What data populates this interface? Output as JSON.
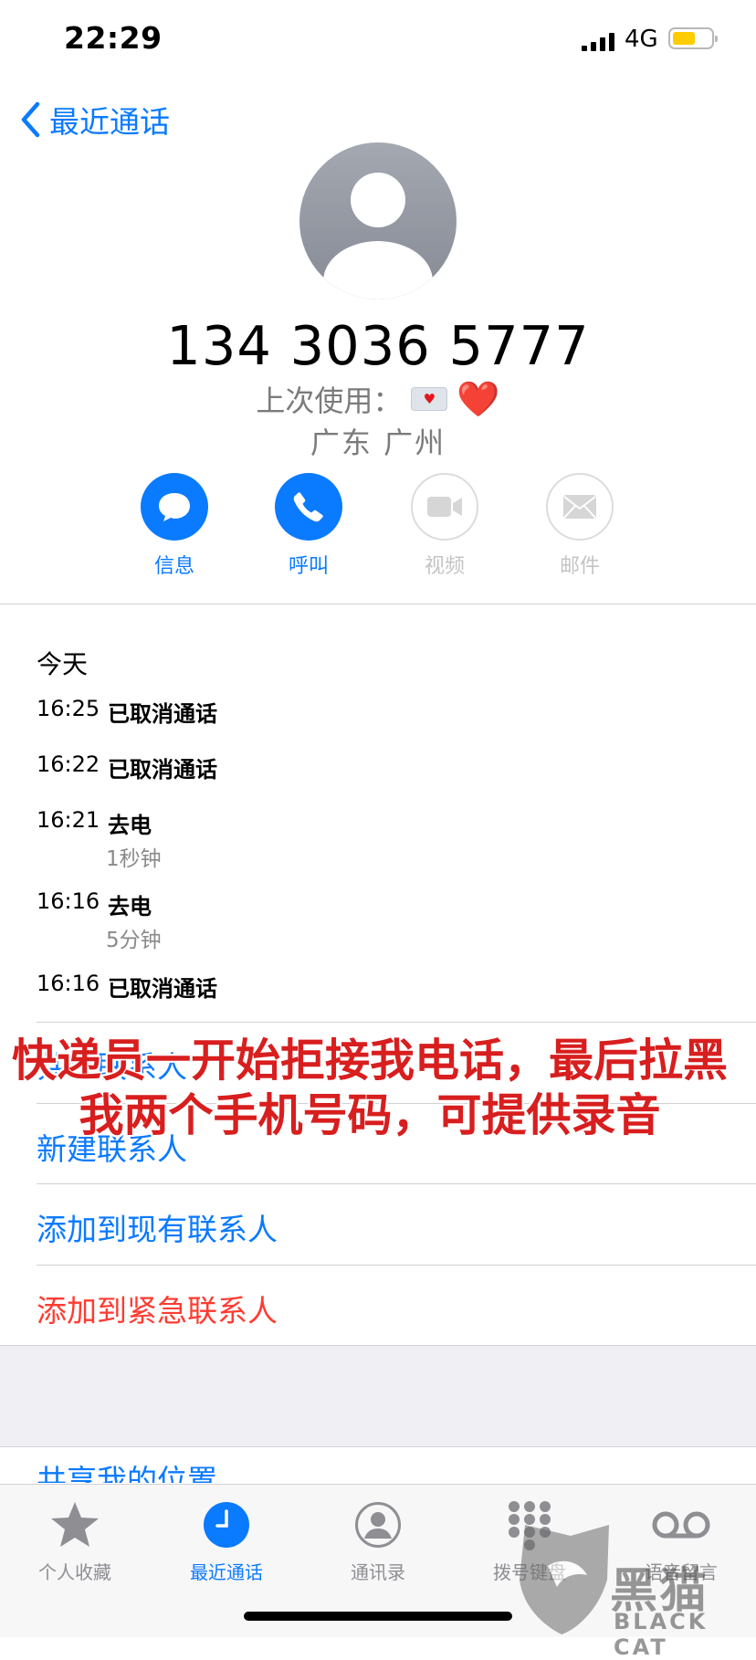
{
  "status_bar": {
    "time": "22:29",
    "network": "4G",
    "battery_level": 0.6,
    "battery_color": "#ffcc00"
  },
  "nav": {
    "back_label": "最近通话"
  },
  "contact": {
    "number": "134 3036 5777",
    "last_used_label": "上次使用：",
    "last_used_badge_icon": "message-heart-badge-icon",
    "last_used_emoji": "❤️",
    "location": "广东 广州"
  },
  "actions": [
    {
      "label": "信息",
      "icon": "message-bubble-icon",
      "enabled": true
    },
    {
      "label": "呼叫",
      "icon": "phone-icon",
      "enabled": true
    },
    {
      "label": "视频",
      "icon": "video-camera-icon",
      "enabled": false
    },
    {
      "label": "邮件",
      "icon": "mail-icon",
      "enabled": false
    }
  ],
  "call_log": {
    "day": "今天",
    "entries": [
      {
        "time": "16:25",
        "type": "已取消通话",
        "duration": ""
      },
      {
        "time": "16:22",
        "type": "已取消通话",
        "duration": ""
      },
      {
        "time": "16:21",
        "type": "去电",
        "duration": "1秒钟"
      },
      {
        "time": "16:16",
        "type": "去电",
        "duration": "5分钟"
      },
      {
        "time": "16:16",
        "type": "已取消通话",
        "duration": ""
      }
    ]
  },
  "contact_actions": [
    {
      "label": "共享联系人",
      "color": "#0a7aff"
    },
    {
      "label": "新建联系人",
      "color": "#0a7aff"
    },
    {
      "label": "添加到现有联系人",
      "color": "#0a7aff"
    },
    {
      "label": "添加到紧急联系人",
      "color": "#ff3b30"
    }
  ],
  "share_location_label": "共享我的位置",
  "overlay_text": "快递员一开始拒接我电话，最后拉黑我两个手机号码，可提供录音",
  "tab_bar": [
    {
      "label": "个人收藏",
      "icon": "star-icon",
      "active": false
    },
    {
      "label": "最近通话",
      "icon": "clock-icon",
      "active": true
    },
    {
      "label": "通讯录",
      "icon": "contacts-icon",
      "active": false
    },
    {
      "label": "拨号键盘",
      "icon": "keypad-icon",
      "active": false
    },
    {
      "label": "语音留言",
      "icon": "voicemail-icon",
      "active": false
    }
  ],
  "watermark": {
    "cn": "黑猫",
    "en": "BLACK CAT"
  }
}
